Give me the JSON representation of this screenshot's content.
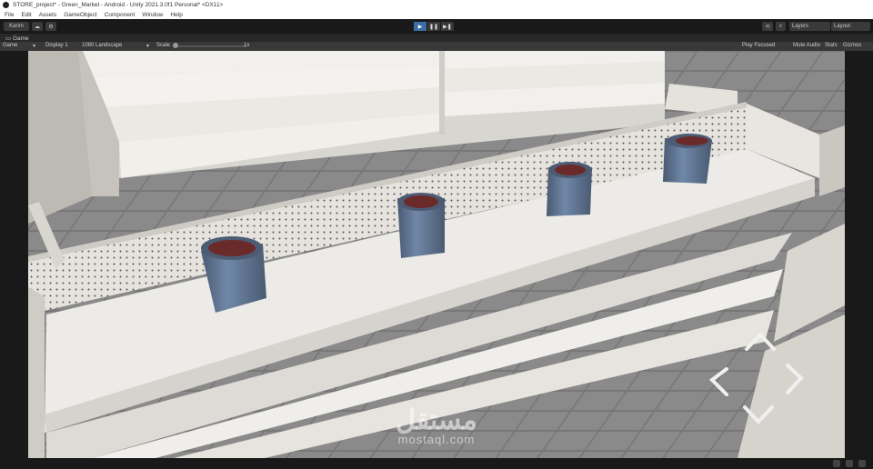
{
  "window": {
    "title": "STORE_project* - Green_Market - Android - Unity 2021.3.0f1 Personal* <DX11>"
  },
  "menu": [
    "File",
    "Edit",
    "Assets",
    "GameObject",
    "Component",
    "Window",
    "Help"
  ],
  "toolbar": {
    "account": "Karim",
    "cloud_icon": "cloud-icon",
    "play_icon": "play-icon",
    "pause_icon": "pause-icon",
    "step_icon": "step-icon",
    "layers_label": "Layers",
    "layout_label": "Layout"
  },
  "tabs": {
    "scene": "Game"
  },
  "game_bar": {
    "display_type": "Game",
    "display": "Display 1",
    "resolution": "1080 Landscape",
    "scale_label": "Scale",
    "scale_value": "1x",
    "play_mode": "Play Focused",
    "mute": "Mute Audio",
    "stats": "Stats",
    "gizmos": "Gizmos"
  },
  "watermark": {
    "arabic": "مستقل",
    "latin": "mostaql.com"
  },
  "colors": {
    "play_active": "#3a6ea5",
    "editor_bg": "#191919",
    "panel": "#383838"
  }
}
